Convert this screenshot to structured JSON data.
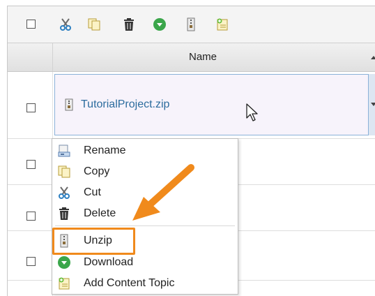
{
  "toolbar": {
    "icons": [
      "select-all-checkbox",
      "cut-icon",
      "copy-icon",
      "delete-icon",
      "download-icon",
      "unzip-icon",
      "add-content-topic-icon"
    ]
  },
  "table": {
    "header": {
      "name": "Name"
    },
    "rows": [
      {
        "name": "TutorialProject.zip",
        "selected": true
      }
    ]
  },
  "context_menu": {
    "items": [
      {
        "id": "rename",
        "label": "Rename",
        "icon": "rename-icon"
      },
      {
        "id": "copy",
        "label": "Copy",
        "icon": "copy-icon"
      },
      {
        "id": "cut",
        "label": "Cut",
        "icon": "cut-icon"
      },
      {
        "id": "delete",
        "label": "Delete",
        "icon": "delete-icon"
      },
      {
        "id": "unzip",
        "label": "Unzip",
        "icon": "unzip-icon"
      },
      {
        "id": "download",
        "label": "Download",
        "icon": "download-icon"
      },
      {
        "id": "add-content-topic",
        "label": "Add Content Topic",
        "icon": "add-content-topic-icon"
      }
    ],
    "highlighted": "unzip"
  },
  "colors": {
    "accent": "#f08a1c",
    "link": "#2c6c9e",
    "selection_border": "#8ab1d8",
    "download_green": "#3aa64a"
  }
}
